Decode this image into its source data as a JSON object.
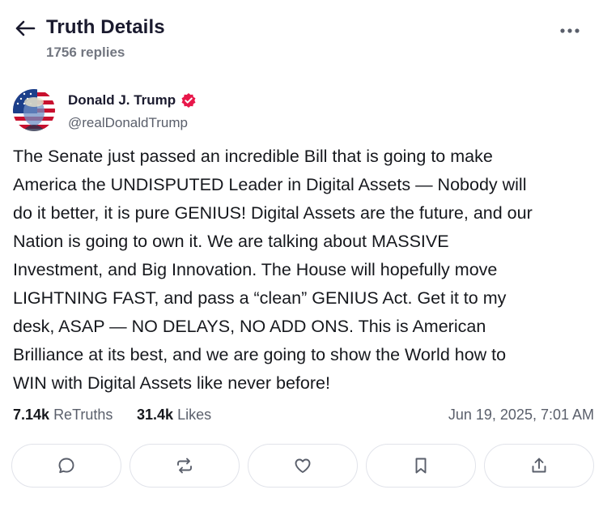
{
  "header": {
    "title": "Truth Details",
    "reply_count": "1756 replies"
  },
  "author": {
    "name": "Donald J. Trump",
    "handle": "@realDonaldTrump",
    "verified": true
  },
  "post": {
    "text": "The Senate just passed an incredible Bill that is going to make\nAmerica the UNDISPUTED Leader in Digital Assets — Nobody will\ndo it better, it is pure GENIUS! Digital Assets are the future, and our\nNation is going to own it. We are talking about MASSIVE\nInvestment, and Big Innovation. The House will hopefully move\nLIGHTNING FAST, and pass a “clean” GENIUS Act. Get it to my\ndesk, ASAP — NO DELAYS, NO ADD ONS. This is American\nBrilliance at its best, and we are going to show the World how to\nWIN with Digital Assets like never before!"
  },
  "stats": {
    "retruths_count": "7.14k",
    "retruths_label": "ReTruths",
    "likes_count": "31.4k",
    "likes_label": "Likes",
    "timestamp": "Jun 19, 2025, 7:01 AM"
  },
  "actions": [
    "reply-icon",
    "retruth-icon",
    "like-icon",
    "bookmark-icon",
    "share-icon"
  ],
  "colors": {
    "verified_badge": "#e8174a",
    "border": "#e1e3ea",
    "icon": "#5a5f6b",
    "text": "#16181d",
    "muted": "#5a5f6b"
  }
}
